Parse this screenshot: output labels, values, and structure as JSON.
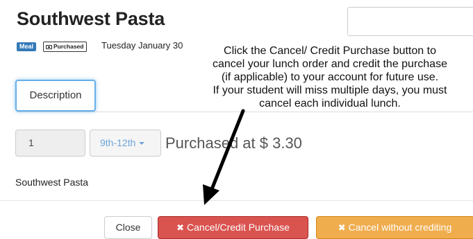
{
  "header": {
    "title": "Southwest Pasta",
    "badge_meal": "Meal",
    "badge_purchased": "Purchased",
    "date": "Tuesday January 30"
  },
  "annotation": {
    "lines": [
      "Click the Cancel/ Credit Purchase button to",
      "cancel your lunch order and credit the purchase",
      "(if applicable) to your account for future use.",
      "If your student will miss multiple days, you must",
      "cancel each individual lunch."
    ]
  },
  "tabs": {
    "description_label": "Description"
  },
  "order": {
    "quantity": "1",
    "grade": "9th-12th",
    "purchased_text": "Purchased at $ 3.30",
    "item_name": "Southwest Pasta"
  },
  "footer": {
    "close_label": "Close",
    "cancel_credit_label": "Cancel/Credit Purchase",
    "cancel_nocredit_label": "Cancel without crediting"
  },
  "colors": {
    "primary": "#337ab7",
    "danger": "#d9534f",
    "warning": "#f0ad4e",
    "focus": "#66afe9"
  }
}
